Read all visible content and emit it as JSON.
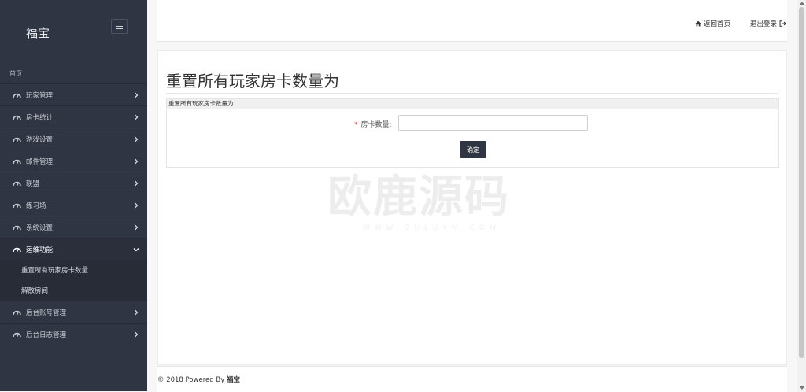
{
  "sidebar": {
    "brand": "福宝",
    "home": "首页",
    "items": [
      {
        "label": "玩家管理"
      },
      {
        "label": "房卡统计"
      },
      {
        "label": "游戏设置"
      },
      {
        "label": "邮件管理"
      },
      {
        "label": "联盟"
      },
      {
        "label": "练习场"
      },
      {
        "label": "系统设置"
      },
      {
        "label": "运维功能"
      },
      {
        "label": "后台账号管理"
      },
      {
        "label": "后台日志管理"
      }
    ],
    "subitems": [
      {
        "label": "重置所有玩家房卡数量"
      },
      {
        "label": "解散房间"
      }
    ]
  },
  "topbar": {
    "home_link": "返回首页",
    "logout_link": "退出登录"
  },
  "main": {
    "page_title": "重置所有玩家房卡数量为",
    "box_title": "重置所有玩家房卡数量为",
    "field_label": "房卡数量:",
    "field_value": "",
    "confirm_label": "确定"
  },
  "watermark": {
    "main": "欧鹿源码",
    "sub": "WWW.OULUYM.COM"
  },
  "footer": {
    "prefix": "© 2018 Powered By ",
    "brand": "福宝"
  }
}
